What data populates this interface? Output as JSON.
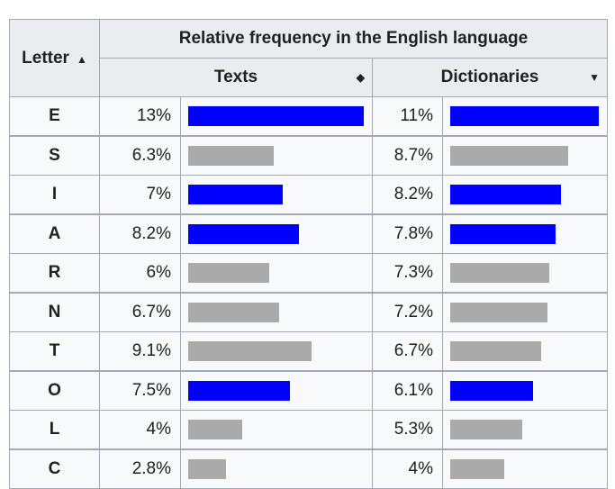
{
  "header": {
    "letter": "Letter",
    "group": "Relative frequency in the English language",
    "texts": "Texts",
    "dictionaries": "Dictionaries",
    "sort_icon": "sort-both-icon",
    "sorted_icon": "sort-desc-icon"
  },
  "colors": {
    "highlight": "#0000ff",
    "normal": "#aaaaaa"
  },
  "rows": [
    {
      "letter": "E",
      "texts": "13%",
      "tv": 13,
      "dict": "11%",
      "dv": 11,
      "highlight": true
    },
    {
      "letter": "S",
      "texts": "6.3%",
      "tv": 6.3,
      "dict": "8.7%",
      "dv": 8.7,
      "highlight": false
    },
    {
      "letter": "I",
      "texts": "7%",
      "tv": 7,
      "dict": "8.2%",
      "dv": 8.2,
      "highlight": true
    },
    {
      "letter": "A",
      "texts": "8.2%",
      "tv": 8.2,
      "dict": "7.8%",
      "dv": 7.8,
      "highlight": true
    },
    {
      "letter": "R",
      "texts": "6%",
      "tv": 6,
      "dict": "7.3%",
      "dv": 7.3,
      "highlight": false
    },
    {
      "letter": "N",
      "texts": "6.7%",
      "tv": 6.7,
      "dict": "7.2%",
      "dv": 7.2,
      "highlight": false
    },
    {
      "letter": "T",
      "texts": "9.1%",
      "tv": 9.1,
      "dict": "6.7%",
      "dv": 6.7,
      "highlight": false
    },
    {
      "letter": "O",
      "texts": "7.5%",
      "tv": 7.5,
      "dict": "6.1%",
      "dv": 6.1,
      "highlight": true
    },
    {
      "letter": "L",
      "texts": "4%",
      "tv": 4,
      "dict": "5.3%",
      "dv": 5.3,
      "highlight": false
    },
    {
      "letter": "C",
      "texts": "2.8%",
      "tv": 2.8,
      "dict": "4%",
      "dv": 4,
      "highlight": false
    }
  ]
}
